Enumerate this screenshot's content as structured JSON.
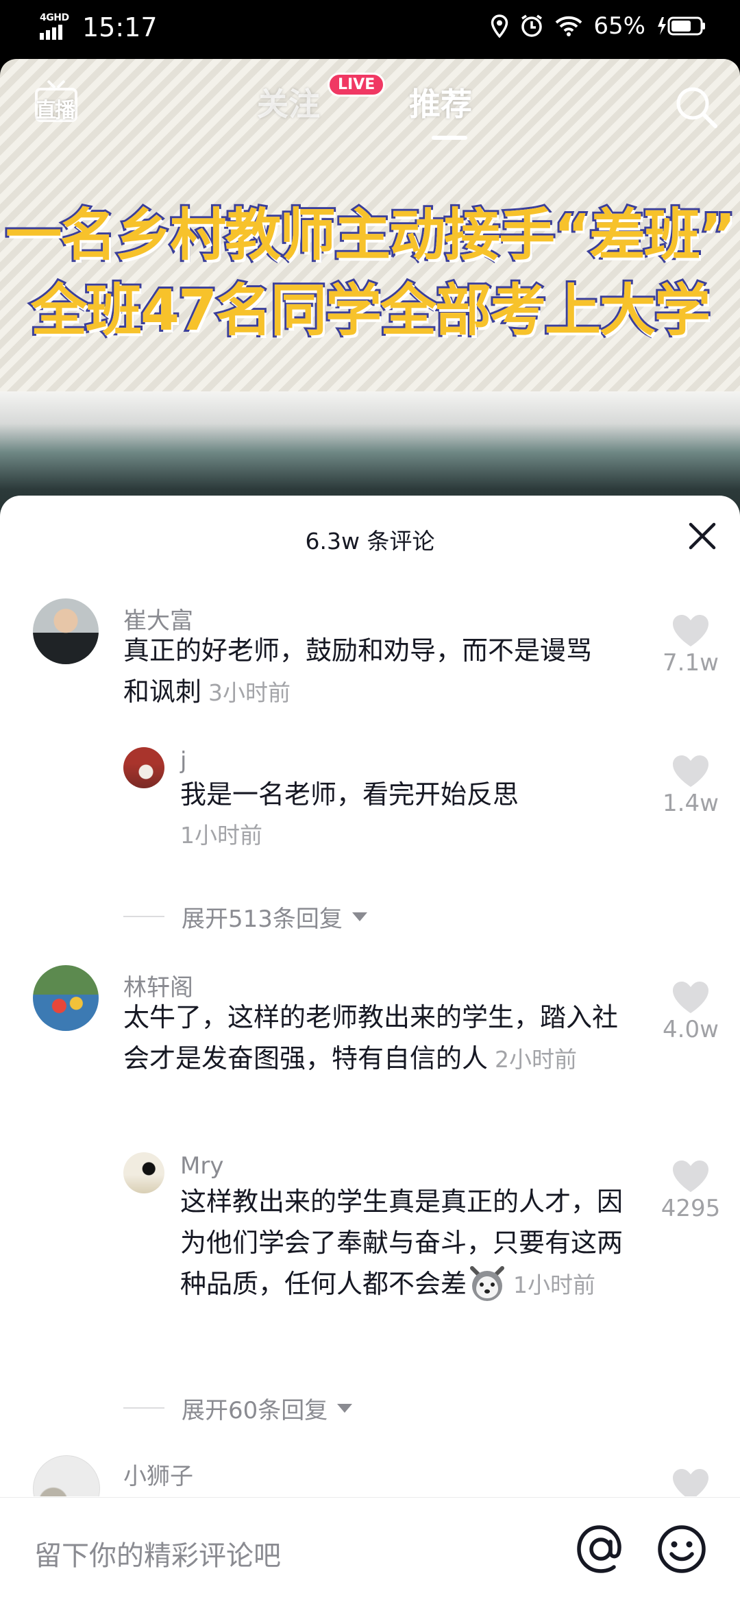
{
  "status_bar": {
    "network": "4GHD",
    "time": "15:17",
    "battery": "65%"
  },
  "video": {
    "caption_line1": "一名乡村教师主动接手“差班”",
    "caption_line2": "全班47名同学全部考上大学"
  },
  "top_nav": {
    "live_label": "直播",
    "tab_follow": "关注",
    "live_badge": "LIVE",
    "tab_recommend": "推荐"
  },
  "sheet": {
    "title": "6.3w 条评论"
  },
  "comments": [
    {
      "user": "崔大富",
      "text": "真正的好老师，鼓励和劝导，而不是谩骂和讽刺",
      "time": "3小时前",
      "likes": "7.1w",
      "reply": {
        "user": "j",
        "text": "我是一名老师，看完开始反思",
        "time": "1小时前",
        "likes": "1.4w"
      },
      "expand": "展开513条回复"
    },
    {
      "user": "林轩阁",
      "text": "太牛了，这样的老师教出来的学生，踏入社会才是发奋图强，特有自信的人",
      "time": "2小时前",
      "likes": "4.0w",
      "reply": {
        "user": "Mry",
        "text": "这样教出来的学生真是真正的人才，因为他们学会了奉献与奋斗，只要有这两种品质，任何人都不会差",
        "time": "1小时前",
        "likes": "4295"
      },
      "expand": "展开60条回复"
    },
    {
      "user": "小狮子"
    }
  ],
  "input": {
    "placeholder": "留下你的精彩评论吧"
  }
}
